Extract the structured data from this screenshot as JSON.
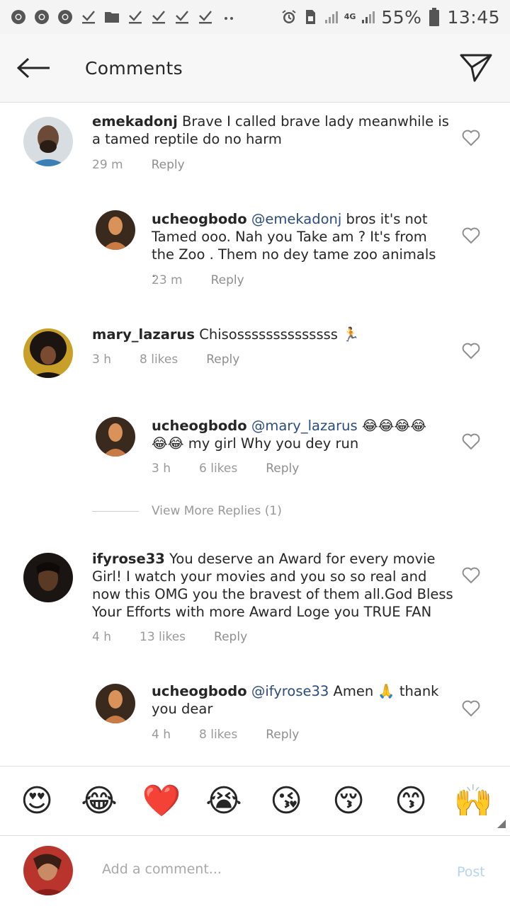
{
  "status_bar": {
    "battery": "55%",
    "time": "13:45",
    "network": "4G",
    "left_icons": [
      "chrome-icon",
      "chrome-icon",
      "chrome-icon",
      "download-done-icon",
      "folder-icon",
      "download-done-icon",
      "download-done-icon",
      "download-done-icon",
      "download-done-icon",
      "more-dots-icon"
    ]
  },
  "header": {
    "title": "Comments"
  },
  "comments": [
    {
      "username": "emekadonj",
      "text": " Brave I called brave lady meanwhile is a tamed reptile do no harm",
      "time": "29 m",
      "likes": "",
      "reply": "Reply"
    },
    {
      "username": "ucheogbodo",
      "mention": "@emekadonj",
      "text": " bros it's not Tamed ooo. Nah you Take am ? It's from the Zoo . Them no dey tame zoo animals .",
      "time": "23 m",
      "likes": "",
      "reply": "Reply"
    },
    {
      "username": "mary_lazarus",
      "text": " Chisossssssssssssss 🏃",
      "time": "3 h",
      "likes": "8 likes",
      "reply": "Reply"
    },
    {
      "username": "ucheogbodo",
      "mention": "@mary_lazarus",
      "text": " 😂😂😂😂😂😂 my girl Why you dey run",
      "time": "3 h",
      "likes": "6 likes",
      "reply": "Reply"
    },
    {
      "username": "ifyrose33",
      "text": " You deserve an Award for every movie Girl! I watch your movies and you so so real and now this OMG you the bravest of them all.God Bless Your Efforts with more Award Loge you TRUE FAN",
      "time": "4 h",
      "likes": "13 likes",
      "reply": "Reply"
    },
    {
      "username": "ucheogbodo",
      "mention": "@ifyrose33",
      "text": " Amen 🙏 thank you dear",
      "time": "4 h",
      "likes": "8 likes",
      "reply": "Reply"
    }
  ],
  "view_more": "View More Replies (1)",
  "emoji_bar": [
    "😍",
    "😂",
    "❤️",
    "😭",
    "😘",
    "😚",
    "😙",
    "🙌"
  ],
  "compose": {
    "placeholder": "Add a comment...",
    "post_label": "Post"
  },
  "colors": {
    "mention": "#2b4c7e",
    "post_disabled": "#b5d4f4",
    "meta": "#999999"
  }
}
